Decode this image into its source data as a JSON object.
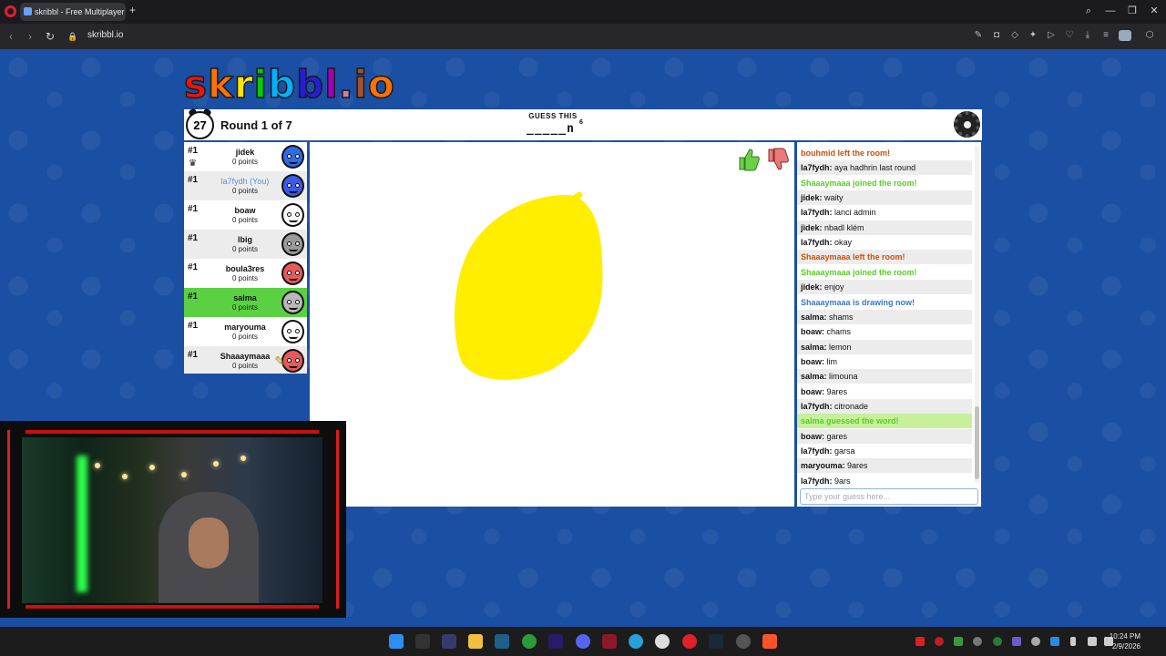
{
  "browser": {
    "tab_title": "skribbl - Free Multiplayer",
    "new_tab": "+",
    "back": "‹",
    "forward": "›",
    "reload": "↻",
    "lock": "🔒",
    "url": "skribbl.io",
    "minimize": "—",
    "restore": "❐",
    "close": "✕",
    "search": "⌕"
  },
  "logo": "skribbl.io",
  "logo_colors": [
    "#ef130b",
    "#ff7100",
    "#ffe400",
    "#00cc00",
    "#00b2ff",
    "#231fd3",
    "#a300ba",
    "#d37caa",
    "#a0522d",
    "#ff7100"
  ],
  "header": {
    "timer": "27",
    "round": "Round 1 of 7",
    "guess_label": "GUESS THIS",
    "word_hint": "_____n",
    "word_length": "6"
  },
  "players": [
    {
      "rank": "#1",
      "name": "jidek",
      "points": "0 points",
      "color": "#2e6be6",
      "owner": true
    },
    {
      "rank": "#1",
      "name": "la7fydh (You)",
      "points": "0 points",
      "color": "#3a5be8",
      "you": true
    },
    {
      "rank": "#1",
      "name": "boaw",
      "points": "0 points",
      "color": "#ffffff"
    },
    {
      "rank": "#1",
      "name": "lbig",
      "points": "0 points",
      "color": "#9a9a9a"
    },
    {
      "rank": "#1",
      "name": "boula3res",
      "points": "0 points",
      "color": "#e85a5a"
    },
    {
      "rank": "#1",
      "name": "salma",
      "points": "0 points",
      "color": "#b8b8b8",
      "guessed": true
    },
    {
      "rank": "#1",
      "name": "maryouma",
      "points": "0 points",
      "color": "#ffffff"
    },
    {
      "rank": "#1",
      "name": "Shaaaymaaa",
      "points": "0 points",
      "color": "#e85a5a",
      "drawing": true
    }
  ],
  "chat": [
    {
      "type": "orange",
      "text": "bouhmid left the room!"
    },
    {
      "type": "normal",
      "author": "la7fydh:",
      "text": " aya hadhrin last round"
    },
    {
      "type": "green",
      "text": "Shaaaymaaa joined the room!"
    },
    {
      "type": "normal",
      "author": "jidek:",
      "text": " waity"
    },
    {
      "type": "normal",
      "author": "la7fydh:",
      "text": " lanci admin"
    },
    {
      "type": "normal",
      "author": "jidek:",
      "text": " nbadl klém"
    },
    {
      "type": "normal",
      "author": "la7fydh:",
      "text": " okay"
    },
    {
      "type": "orange",
      "text": "Shaaaymaaa left the room!"
    },
    {
      "type": "green",
      "text": "Shaaaymaaa joined the room!"
    },
    {
      "type": "normal",
      "author": "jidek:",
      "text": " enjoy"
    },
    {
      "type": "blue",
      "text": "Shaaaymaaa is drawing now!"
    },
    {
      "type": "normal",
      "author": "salma:",
      "text": " shams"
    },
    {
      "type": "normal",
      "author": "boaw:",
      "text": " chams"
    },
    {
      "type": "normal",
      "author": "salma:",
      "text": " lemon"
    },
    {
      "type": "normal",
      "author": "boaw:",
      "text": " lim"
    },
    {
      "type": "normal",
      "author": "salma:",
      "text": " limouna"
    },
    {
      "type": "normal",
      "author": "boaw:",
      "text": " 9ares"
    },
    {
      "type": "normal",
      "author": "la7fydh:",
      "text": " citronade"
    },
    {
      "type": "guessed",
      "text": "salma guessed the word!"
    },
    {
      "type": "normal",
      "author": "boaw:",
      "text": " gares"
    },
    {
      "type": "normal",
      "author": "la7fydh:",
      "text": " garsa"
    },
    {
      "type": "normal",
      "author": "maryouma:",
      "text": " 9ares"
    },
    {
      "type": "normal",
      "author": "la7fydh:",
      "text": " 9ars"
    }
  ],
  "chat_input": {
    "placeholder": "Type your guess here..."
  },
  "taskbar": {
    "time": "10:24 PM",
    "date": "2/9/2026"
  },
  "colors": {
    "page_bg": "#1b4fa3",
    "guessed": "#5ad143",
    "drawing": "#ffee00",
    "webcam_frame": "#e31b1b"
  }
}
